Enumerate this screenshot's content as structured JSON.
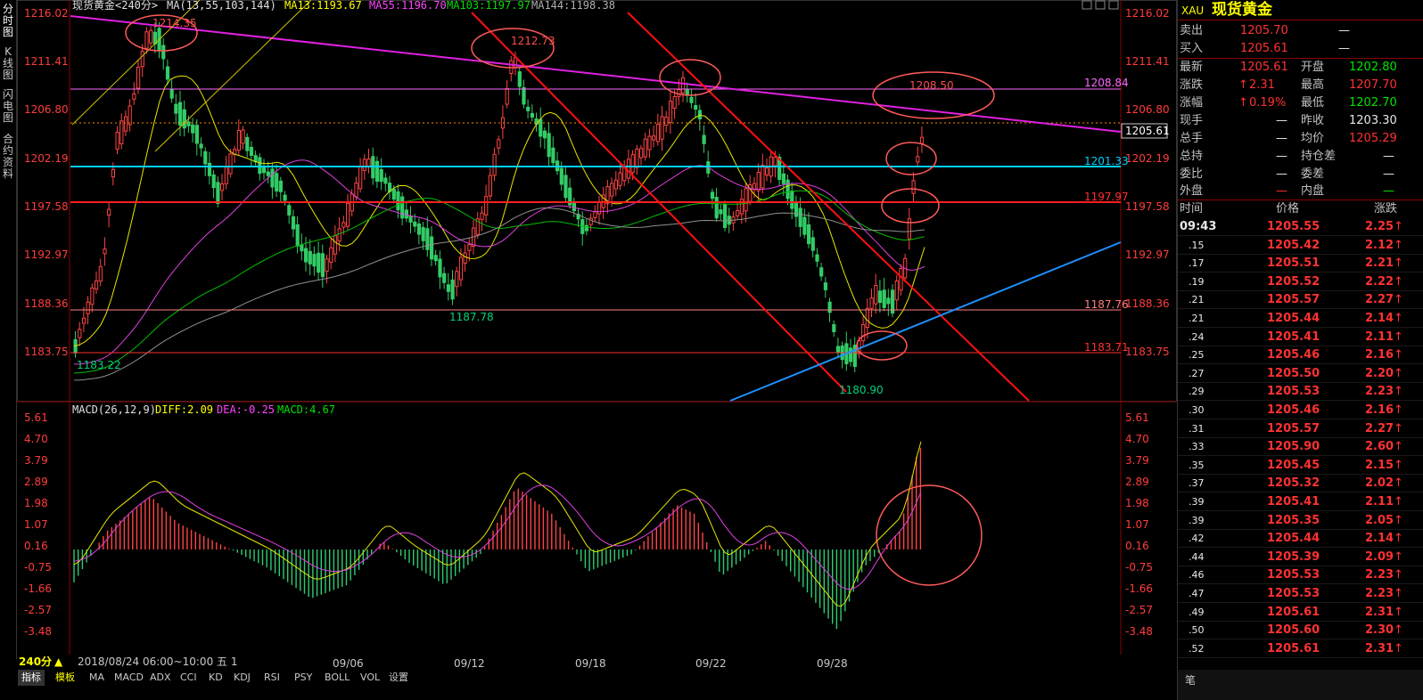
{
  "left_toolbar": {
    "items": [
      {
        "label": "分时图"
      },
      {
        "label": "K线图"
      },
      {
        "label": "闪电图"
      },
      {
        "label": "合约资料"
      }
    ]
  },
  "chart_header": {
    "title": "现货黄金<240分>",
    "ma": "MA(13,55,103,144)",
    "ma13": "MA13:1193.67",
    "ma55": "MA55:1196.70",
    "ma103": "MA103:1197.97",
    "ma144": "MA144:1198.38"
  },
  "macd_header": {
    "label": "MACD(26,12,9)",
    "diff": "DIFF:2.09",
    "dea": "DEA:-0.25",
    "macd": "MACD:4.67"
  },
  "price_axis": [
    "1216.02",
    "1211.41",
    "1206.80",
    "1202.19",
    "1197.58",
    "1192.97",
    "1188.36",
    "1183.75"
  ],
  "macd_axis": [
    "5.61",
    "4.70",
    "3.79",
    "2.89",
    "1.98",
    "1.07",
    "0.16",
    "-0.75",
    "-1.66",
    "-2.57",
    "-3.48"
  ],
  "level_labels": {
    "l1": "1208.84",
    "l2": "1201.33",
    "l3": "1197.97",
    "l4": "1187.76",
    "l5": "1183.71",
    "current": "1205.61"
  },
  "annotations": {
    "a1": "1214.35",
    "a2": "1212.73",
    "a3": "1208.50",
    "a4": "1187.78",
    "a5": "1183.22",
    "a6": "1180.90"
  },
  "x_axis": {
    "period_label": "240分",
    "range": "2018/08/24 06:00~10:00 五 1",
    "ticks": [
      "09/06",
      "09/12",
      "09/18",
      "09/22",
      "09/28"
    ]
  },
  "bottom_tabs": [
    "指标",
    "模板",
    "MA",
    "MACD",
    "ADX",
    "CCI",
    "KD",
    "KDJ",
    "RSI",
    "PSY",
    "BOLL",
    "VOL",
    "设置"
  ],
  "quote": {
    "symbol": "XAU",
    "name": "现货黄金",
    "sell_label": "卖出",
    "sell": "1205.70",
    "sell_vol": "—",
    "buy_label": "买入",
    "buy": "1205.61",
    "buy_vol": "—",
    "last_label": "最新",
    "last": "1205.61",
    "open_label": "开盘",
    "open": "1202.80",
    "chg_label": "涨跌",
    "chg": "2.31",
    "high_label": "最高",
    "high": "1207.70",
    "pct_label": "涨幅",
    "pct": "0.19%",
    "low_label": "最低",
    "low": "1202.70",
    "now_label": "现手",
    "now": "—",
    "prev_label": "昨收",
    "prev": "1203.30",
    "tot_label": "总手",
    "tot": "—",
    "avg_label": "均价",
    "avg": "1205.29",
    "oi_label": "总持",
    "oi": "—",
    "oichg_label": "持仓差",
    "oichg": "—",
    "ratio_label": "委比",
    "ratio": "—",
    "diff_label": "委差",
    "diff": "—",
    "outer_label": "外盘",
    "outer": "—",
    "inner_label": "内盘",
    "inner": "—"
  },
  "ticks_header": {
    "time": "时间",
    "price": "价格",
    "chg": "涨跌"
  },
  "ticks": [
    {
      "t": "09:43",
      "p": "1205.55",
      "c": "2.25"
    },
    {
      "t": ".15",
      "p": "1205.42",
      "c": "2.12"
    },
    {
      "t": ".17",
      "p": "1205.51",
      "c": "2.21"
    },
    {
      "t": ".19",
      "p": "1205.52",
      "c": "2.22"
    },
    {
      "t": ".21",
      "p": "1205.57",
      "c": "2.27"
    },
    {
      "t": ".21",
      "p": "1205.44",
      "c": "2.14"
    },
    {
      "t": ".24",
      "p": "1205.41",
      "c": "2.11"
    },
    {
      "t": ".25",
      "p": "1205.46",
      "c": "2.16"
    },
    {
      "t": ".27",
      "p": "1205.50",
      "c": "2.20"
    },
    {
      "t": ".29",
      "p": "1205.53",
      "c": "2.23"
    },
    {
      "t": ".30",
      "p": "1205.46",
      "c": "2.16"
    },
    {
      "t": ".31",
      "p": "1205.57",
      "c": "2.27"
    },
    {
      "t": ".33",
      "p": "1205.90",
      "c": "2.60"
    },
    {
      "t": ".35",
      "p": "1205.45",
      "c": "2.15"
    },
    {
      "t": ".37",
      "p": "1205.32",
      "c": "2.02"
    },
    {
      "t": ".39",
      "p": "1205.41",
      "c": "2.11"
    },
    {
      "t": ".39",
      "p": "1205.35",
      "c": "2.05"
    },
    {
      "t": ".42",
      "p": "1205.44",
      "c": "2.14"
    },
    {
      "t": ".44",
      "p": "1205.39",
      "c": "2.09"
    },
    {
      "t": ".46",
      "p": "1205.53",
      "c": "2.23"
    },
    {
      "t": ".47",
      "p": "1205.53",
      "c": "2.23"
    },
    {
      "t": ".49",
      "p": "1205.61",
      "c": "2.31"
    },
    {
      "t": ".50",
      "p": "1205.60",
      "c": "2.30"
    },
    {
      "t": ".52",
      "p": "1205.61",
      "c": "2.31"
    }
  ],
  "panel_footer": "笔"
}
